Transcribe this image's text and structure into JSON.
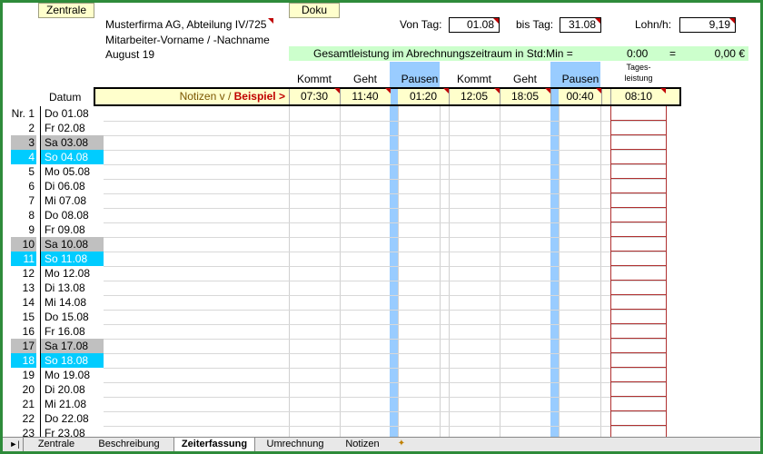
{
  "buttons": {
    "zentrale": "Zentrale",
    "doku": "Doku"
  },
  "header": {
    "company": "Musterfirma AG, Abteilung IV/725",
    "employee": "Mitarbeiter-Vorname / -Nachname",
    "month": "August 19",
    "von_label": "Von Tag:",
    "von_value": "01.08",
    "bis_label": "bis Tag:",
    "bis_value": "31.08",
    "lohn_label": "Lohn/h:",
    "lohn_value": "9,19",
    "summary_label": "Gesamtleistung im Abrechnungszeitraum in Std:Min =",
    "summary_time": "0:00",
    "summary_eq": "=",
    "summary_amount": "0,00 €"
  },
  "columns": {
    "datum": "Datum",
    "kommt1": "Kommt",
    "geht1": "Geht",
    "pausen1": "Pausen",
    "kommt2": "Kommt",
    "geht2": "Geht",
    "pausen2": "Pausen",
    "tages1": "Tages-",
    "tages2": "leistung"
  },
  "example": {
    "notizen": "Notizen v / ",
    "beispiel": "Beispiel >",
    "kommt1": "07:30",
    "geht1": "11:40",
    "pausen1": "01:20",
    "kommt2": "12:05",
    "geht2": "18:05",
    "pausen2": "00:40",
    "tagesleistung": "08:10"
  },
  "rows": [
    {
      "nr": "Nr. 1",
      "day": "Do 01.08",
      "type": "weekday"
    },
    {
      "nr": "2",
      "day": "Fr 02.08",
      "type": "weekday"
    },
    {
      "nr": "3",
      "day": "Sa 03.08",
      "type": "saturday"
    },
    {
      "nr": "4",
      "day": "So 04.08",
      "type": "sunday"
    },
    {
      "nr": "5",
      "day": "Mo 05.08",
      "type": "weekday"
    },
    {
      "nr": "6",
      "day": "Di 06.08",
      "type": "weekday"
    },
    {
      "nr": "7",
      "day": "Mi 07.08",
      "type": "weekday"
    },
    {
      "nr": "8",
      "day": "Do 08.08",
      "type": "weekday"
    },
    {
      "nr": "9",
      "day": "Fr 09.08",
      "type": "weekday"
    },
    {
      "nr": "10",
      "day": "Sa 10.08",
      "type": "saturday"
    },
    {
      "nr": "11",
      "day": "So 11.08",
      "type": "sunday"
    },
    {
      "nr": "12",
      "day": "Mo 12.08",
      "type": "weekday"
    },
    {
      "nr": "13",
      "day": "Di 13.08",
      "type": "weekday"
    },
    {
      "nr": "14",
      "day": "Mi 14.08",
      "type": "weekday"
    },
    {
      "nr": "15",
      "day": "Do 15.08",
      "type": "weekday"
    },
    {
      "nr": "16",
      "day": "Fr 16.08",
      "type": "weekday"
    },
    {
      "nr": "17",
      "day": "Sa 17.08",
      "type": "saturday"
    },
    {
      "nr": "18",
      "day": "So 18.08",
      "type": "sunday"
    },
    {
      "nr": "19",
      "day": "Mo 19.08",
      "type": "weekday"
    },
    {
      "nr": "20",
      "day": "Di 20.08",
      "type": "weekday"
    },
    {
      "nr": "21",
      "day": "Mi 21.08",
      "type": "weekday"
    },
    {
      "nr": "22",
      "day": "Do 22.08",
      "type": "weekday"
    },
    {
      "nr": "23",
      "day": "Fr 23.08",
      "type": "weekday"
    }
  ],
  "colors": {
    "saturday": "#c0c0c0",
    "sunday": "#00ccff",
    "frame": "#2e8b3a",
    "summary_bg": "#ccffcc",
    "pause_col": "#99ccff"
  },
  "tabs": [
    "Zentrale",
    "Beschreibung",
    "Zeiterfassung",
    "Umrechnung",
    "Notizen"
  ],
  "active_tab": "Zeiterfassung"
}
